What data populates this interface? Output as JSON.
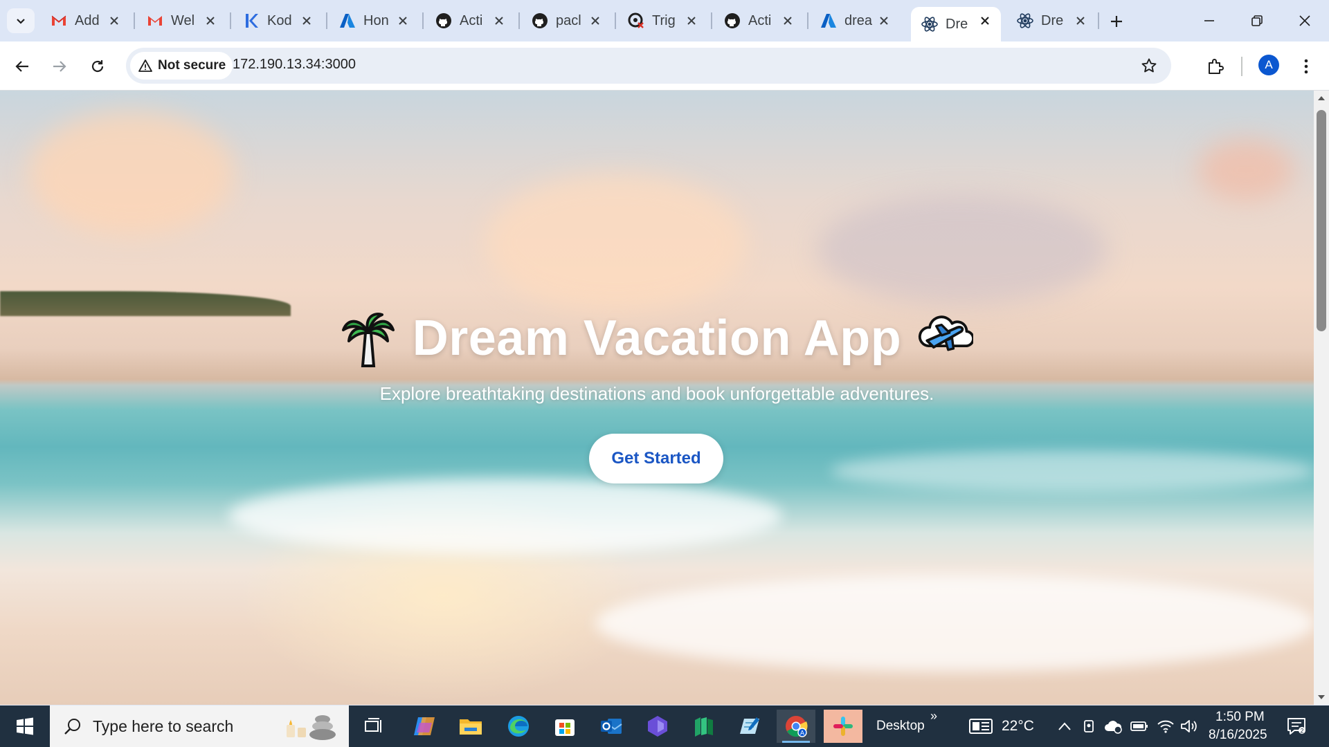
{
  "browser": {
    "tabs": [
      {
        "title": "Add",
        "icon": "gmail-icon",
        "active": false
      },
      {
        "title": "Wel",
        "icon": "gmail-icon",
        "active": false
      },
      {
        "title": "Kod",
        "icon": "kodekloud-icon",
        "active": false
      },
      {
        "title": "Hon",
        "icon": "azure-icon",
        "active": false
      },
      {
        "title": "Acti",
        "icon": "github-icon",
        "active": false
      },
      {
        "title": "pacl",
        "icon": "github-icon",
        "active": false
      },
      {
        "title": "Trig",
        "icon": "github-actions-failed-icon",
        "active": false
      },
      {
        "title": "Acti",
        "icon": "github-icon",
        "active": false
      },
      {
        "title": "drea",
        "icon": "azure-icon",
        "active": false
      },
      {
        "title": "Dre",
        "icon": "react-icon",
        "active": true
      },
      {
        "title": "Dre",
        "icon": "react-icon",
        "active": false
      }
    ],
    "security_label": "Not secure",
    "url": "172.190.13.34:3000",
    "profile_initial": "A"
  },
  "page": {
    "title": "Dream Vacation App",
    "title_emoji_left": "palm-tree",
    "title_emoji_right": "airplane-cloud",
    "subtitle": "Explore breathtaking destinations and book unforgettable adventures.",
    "cta_label": "Get Started"
  },
  "taskbar": {
    "search_placeholder": "Type here to search",
    "desktop_label": "Desktop",
    "overflow_glyph": "»",
    "temperature": "22°C",
    "time": "1:50 PM",
    "date": "8/16/2025",
    "apps": [
      "task-view",
      "copilot",
      "file-explorer",
      "edge",
      "microsoft-store",
      "outlook",
      "clipchamp",
      "excel-like",
      "notepad-like",
      "chrome",
      "slack"
    ]
  },
  "colors": {
    "accent": "#1a56c4",
    "taskbar": "#203040",
    "tabstrip": "#dde6f6"
  }
}
